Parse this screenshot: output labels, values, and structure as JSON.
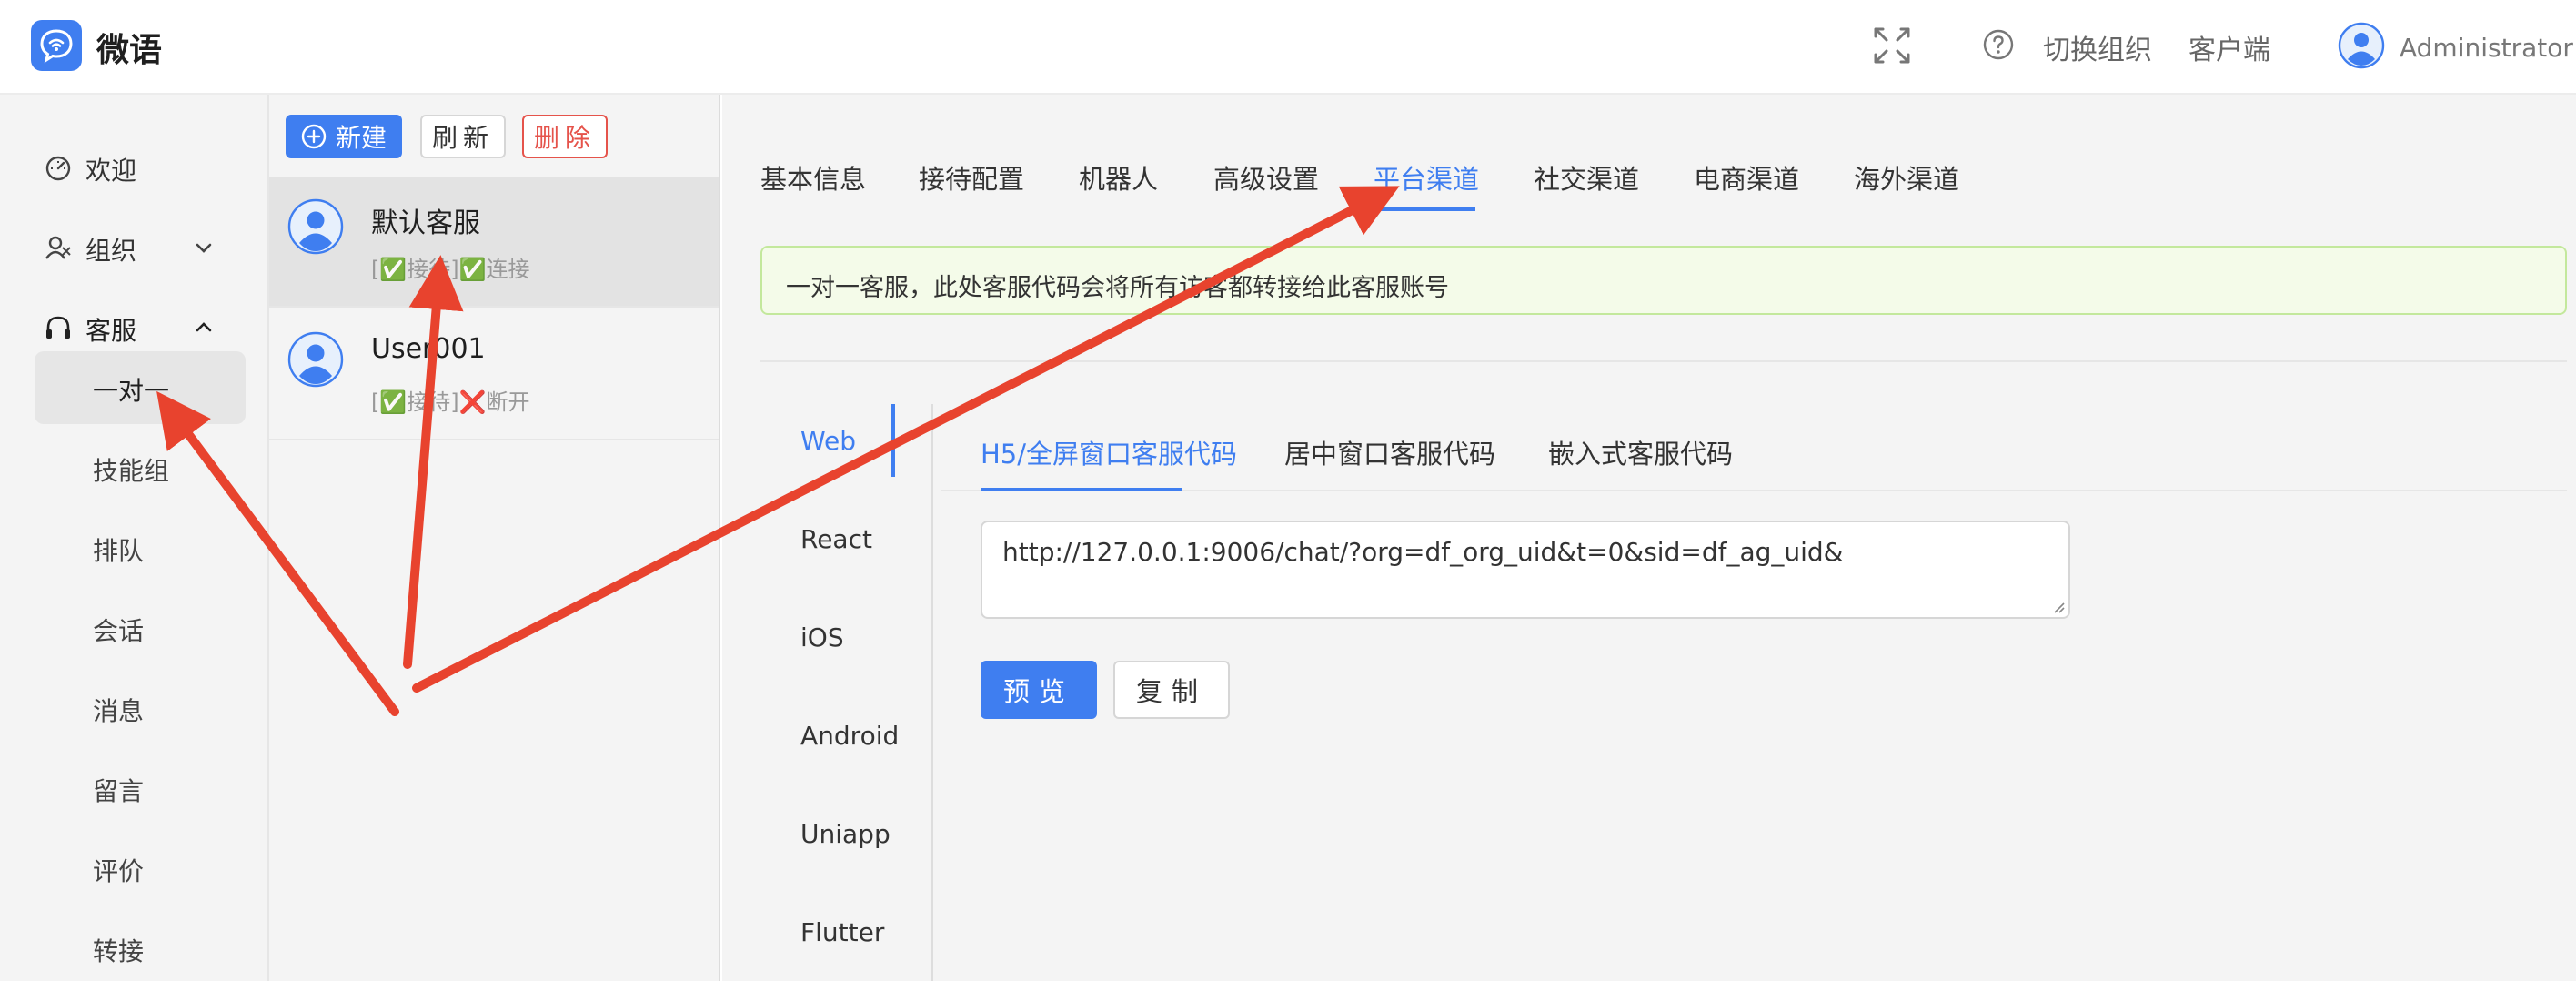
{
  "header": {
    "app_title": "微语",
    "fullscreen_icon": "fullscreen-icon",
    "help_icon": "help-icon",
    "switch_org": "切换组织",
    "client": "客户端",
    "user_name": "Administrator"
  },
  "sidebar": {
    "items": [
      {
        "label": "欢迎",
        "icon": "dashboard-icon"
      },
      {
        "label": "组织",
        "icon": "org-icon",
        "chevron": "chevron-down-icon"
      },
      {
        "label": "客服",
        "icon": "headset-icon",
        "chevron": "chevron-up-icon"
      }
    ],
    "subitems": [
      "一对一",
      "技能组",
      "排队",
      "会话",
      "消息",
      "留言",
      "评价",
      "转接"
    ]
  },
  "agent_list": {
    "new_label": "新建",
    "refresh_label": "刷新",
    "delete_label": "删除",
    "agents": [
      {
        "name": "默认客服",
        "status": "[✅接待]✅连接"
      },
      {
        "name": "User001",
        "status": "[✅接待]❌断开"
      }
    ]
  },
  "main": {
    "tabs": [
      "基本信息",
      "接待配置",
      "机器人",
      "高级设置",
      "平台渠道",
      "社交渠道",
      "电商渠道",
      "海外渠道"
    ],
    "active_tab": "平台渠道",
    "notice": "一对一客服，此处客服代码会将所有访客都转接给此客服账号",
    "platforms": [
      "Web",
      "React",
      "iOS",
      "Android",
      "Uniapp",
      "Flutter"
    ],
    "active_platform": "Web",
    "code_tabs": [
      "H5/全屏窗口客服代码",
      "居中窗口客服代码",
      "嵌入式客服代码"
    ],
    "active_code_tab": "H5/全屏窗口客服代码",
    "code_value": "http://127.0.0.1:9006/chat/?org=df_org_uid&t=0&sid=df_ag_uid&",
    "preview_label": "预览",
    "copy_label": "复制"
  },
  "colors": {
    "accent": "#3f7ef0",
    "danger": "#e5534b",
    "annotation": "#e8432e",
    "notice_bg": "#f4fbe9"
  }
}
